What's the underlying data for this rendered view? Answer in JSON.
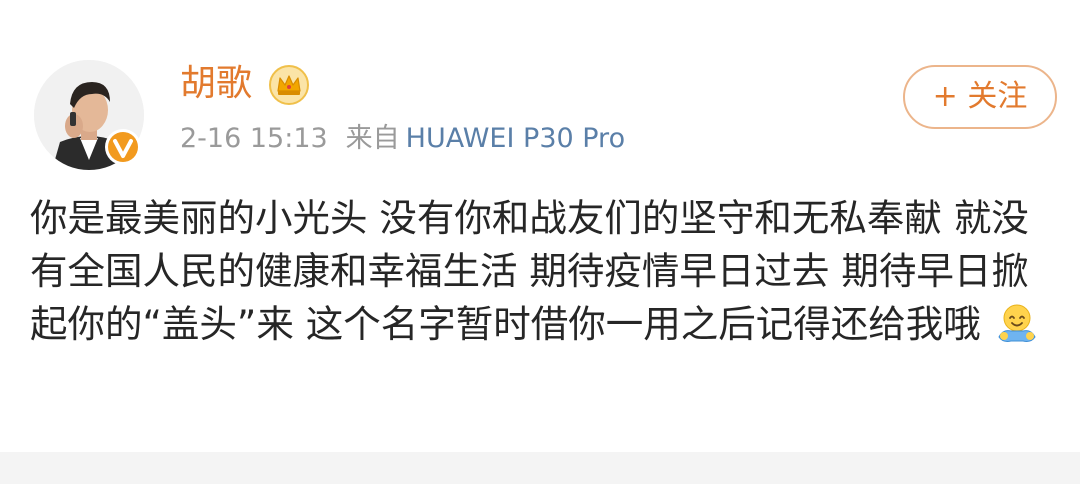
{
  "post": {
    "username": "胡歌",
    "timestamp": "2-16 15:13",
    "source_label": "来自",
    "device": "HUAWEI P30 Pro",
    "follow_label": "+ 关注",
    "text": "你是最美丽的小光头 没有你和战友们的坚守和无私奉献 就没有全国人民的健康和幸福生活 期待疫情早日过去 期待早日掀起你的“盖头”来 这个名字暂时借你一用之后记得还给我哦",
    "emoji": "hug-emoji"
  },
  "icons": {
    "avatar": "profile-photo",
    "verified_badge": "verified-badge-icon",
    "crown": "crown-icon"
  },
  "colors": {
    "username": "#e27a2e",
    "follow_border": "#ecb58b",
    "meta_text": "#9a9a9a",
    "device_text": "#5a7fa8",
    "body_text": "#262626",
    "footer_bg": "#f4f4f4"
  }
}
